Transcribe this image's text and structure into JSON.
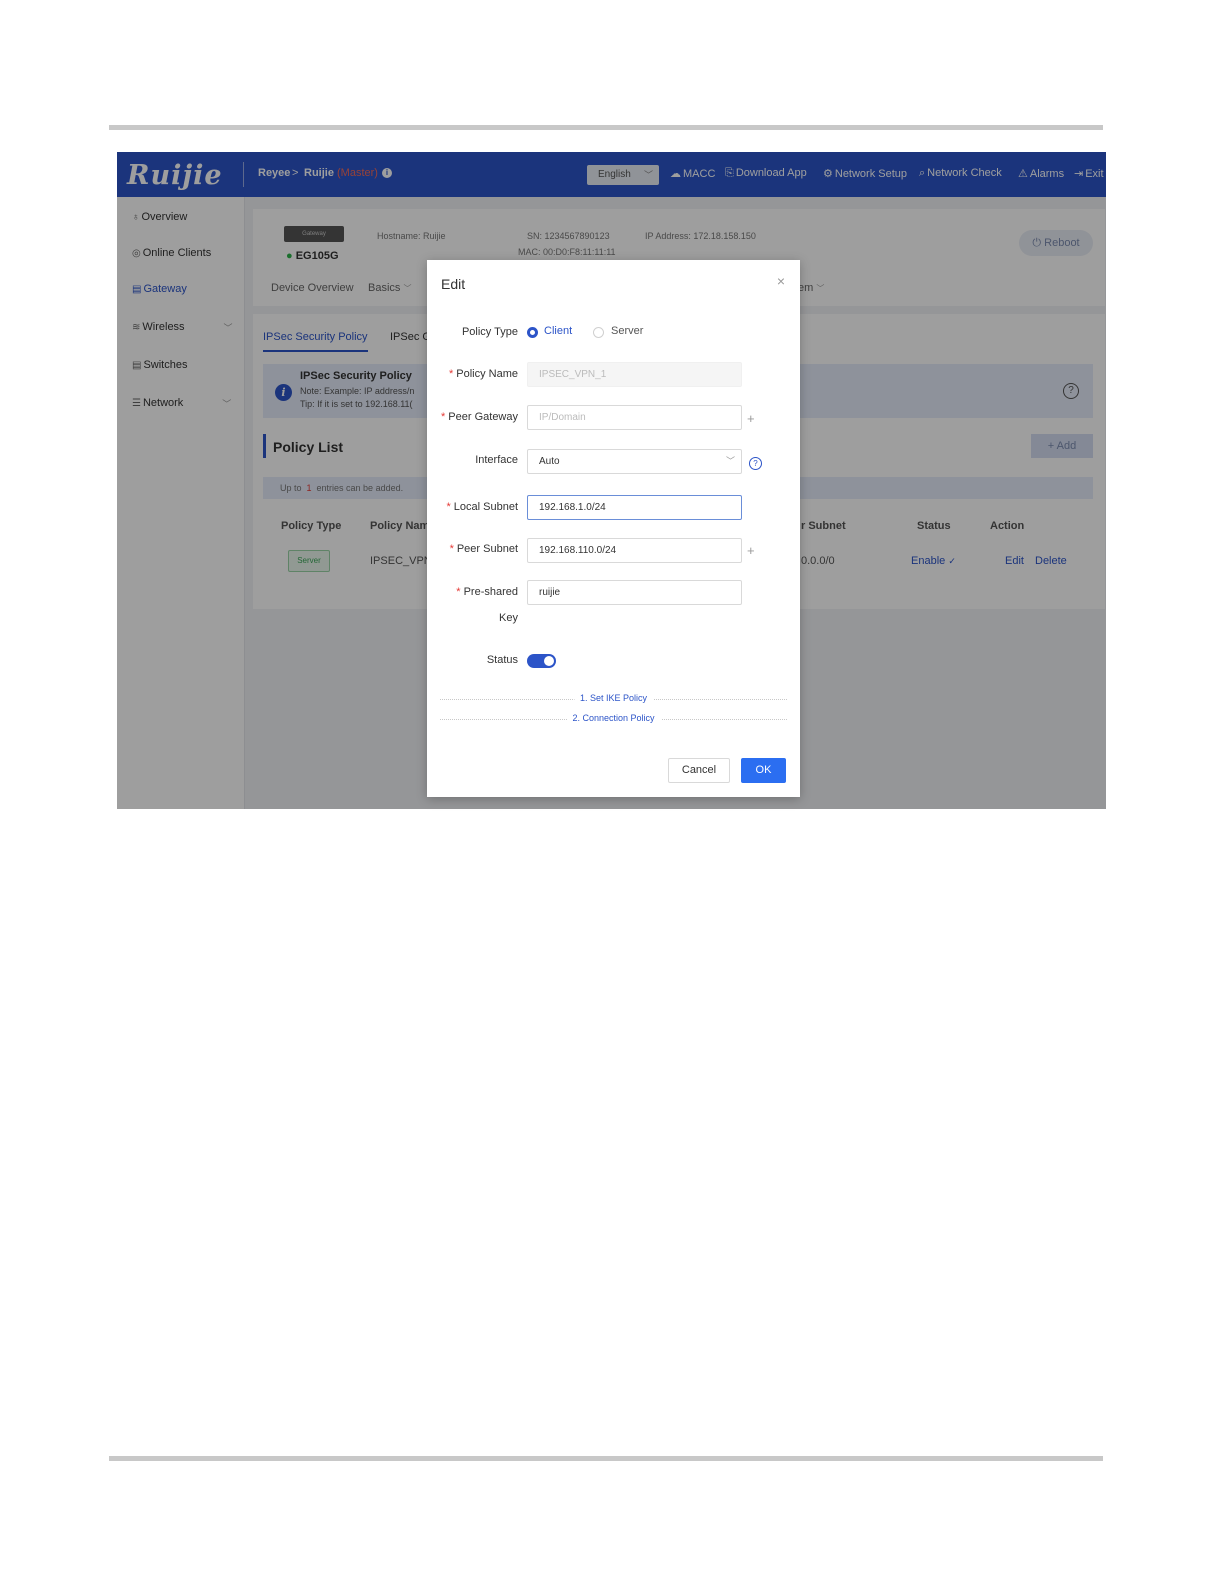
{
  "header": {
    "logo": "Ruijie",
    "crumb_root": "Reyee",
    "crumb_sep": ">",
    "crumb_device": "Ruijie",
    "crumb_role": "(Master)",
    "language": "English",
    "links": [
      {
        "icon": "cloud-icon",
        "glyph": "☁",
        "label": "MACC"
      },
      {
        "icon": "download-icon",
        "glyph": "⎘",
        "label": "Download App"
      },
      {
        "icon": "network-setup-icon",
        "glyph": "⚙",
        "label": "Network Setup"
      },
      {
        "icon": "search-icon",
        "glyph": "⌕",
        "label": "Network Check"
      },
      {
        "icon": "alarm-icon",
        "glyph": "⚠",
        "label": "Alarms"
      },
      {
        "icon": "exit-icon",
        "glyph": "⇥",
        "label": "Exit"
      }
    ]
  },
  "sidebar": {
    "items": [
      {
        "icon": "overview-icon",
        "label": "Overview"
      },
      {
        "icon": "clients-icon",
        "label": "Online Clients"
      },
      {
        "icon": "gateway-icon",
        "label": "Gateway",
        "active": true
      },
      {
        "icon": "wireless-icon",
        "label": "Wireless"
      },
      {
        "icon": "switches-icon",
        "label": "Switches"
      },
      {
        "icon": "network-icon",
        "label": "Network"
      }
    ]
  },
  "device": {
    "box_label": "Gateway",
    "model": "EG105G",
    "hostname": "Hostname: Ruijie",
    "sn": "SN: 1234567890123",
    "mac": "MAC: 00:D0:F8:11:11:11",
    "ip": "IP Address: 172.18.158.150",
    "reboot": "Reboot",
    "tabs": [
      "Device Overview",
      "Basics",
      "em"
    ]
  },
  "policy": {
    "tab_active": "IPSec Security Policy",
    "tab_other": "IPSec G",
    "notice_title": "IPSec Security Policy",
    "note": "Note: Example: IP address/n",
    "tip": "Tip: If it is set to 192.168.11(",
    "list_title": "Policy List",
    "add": "+ Add",
    "limit_pre": "Up to",
    "limit_count": "1",
    "limit_post": "entries can be added.",
    "columns": [
      "Policy Type",
      "Policy Nam",
      "r Subnet",
      "Status",
      "Action"
    ],
    "row": {
      "type": "Server",
      "name": "IPSEC_VPN_",
      "subnet": "0.0.0/0",
      "status": "Enable",
      "edit": "Edit",
      "delete": "Delete"
    }
  },
  "modal": {
    "title": "Edit",
    "close": "×",
    "policy_type_label": "Policy Type",
    "policy_type_options": [
      "Client",
      "Server"
    ],
    "policy_type_selected": "Client",
    "policy_name_label": "Policy Name",
    "policy_name_value": "IPSEC_VPN_1",
    "peer_gateway_label": "Peer Gateway",
    "peer_gateway_placeholder": "IP/Domain",
    "interface_label": "Interface",
    "interface_value": "Auto",
    "local_subnet_label": "Local Subnet",
    "local_subnet_value": "192.168.1.0/24",
    "peer_subnet_label": "Peer Subnet",
    "peer_subnet_value": "192.168.110.0/24",
    "psk_label_1": "Pre-shared",
    "psk_label_2": "Key",
    "psk_value": "ruijie",
    "status_label": "Status",
    "status_on": true,
    "section_1": "1. Set IKE Policy",
    "section_2": "2. Connection Policy",
    "cancel": "Cancel",
    "ok": "OK"
  }
}
